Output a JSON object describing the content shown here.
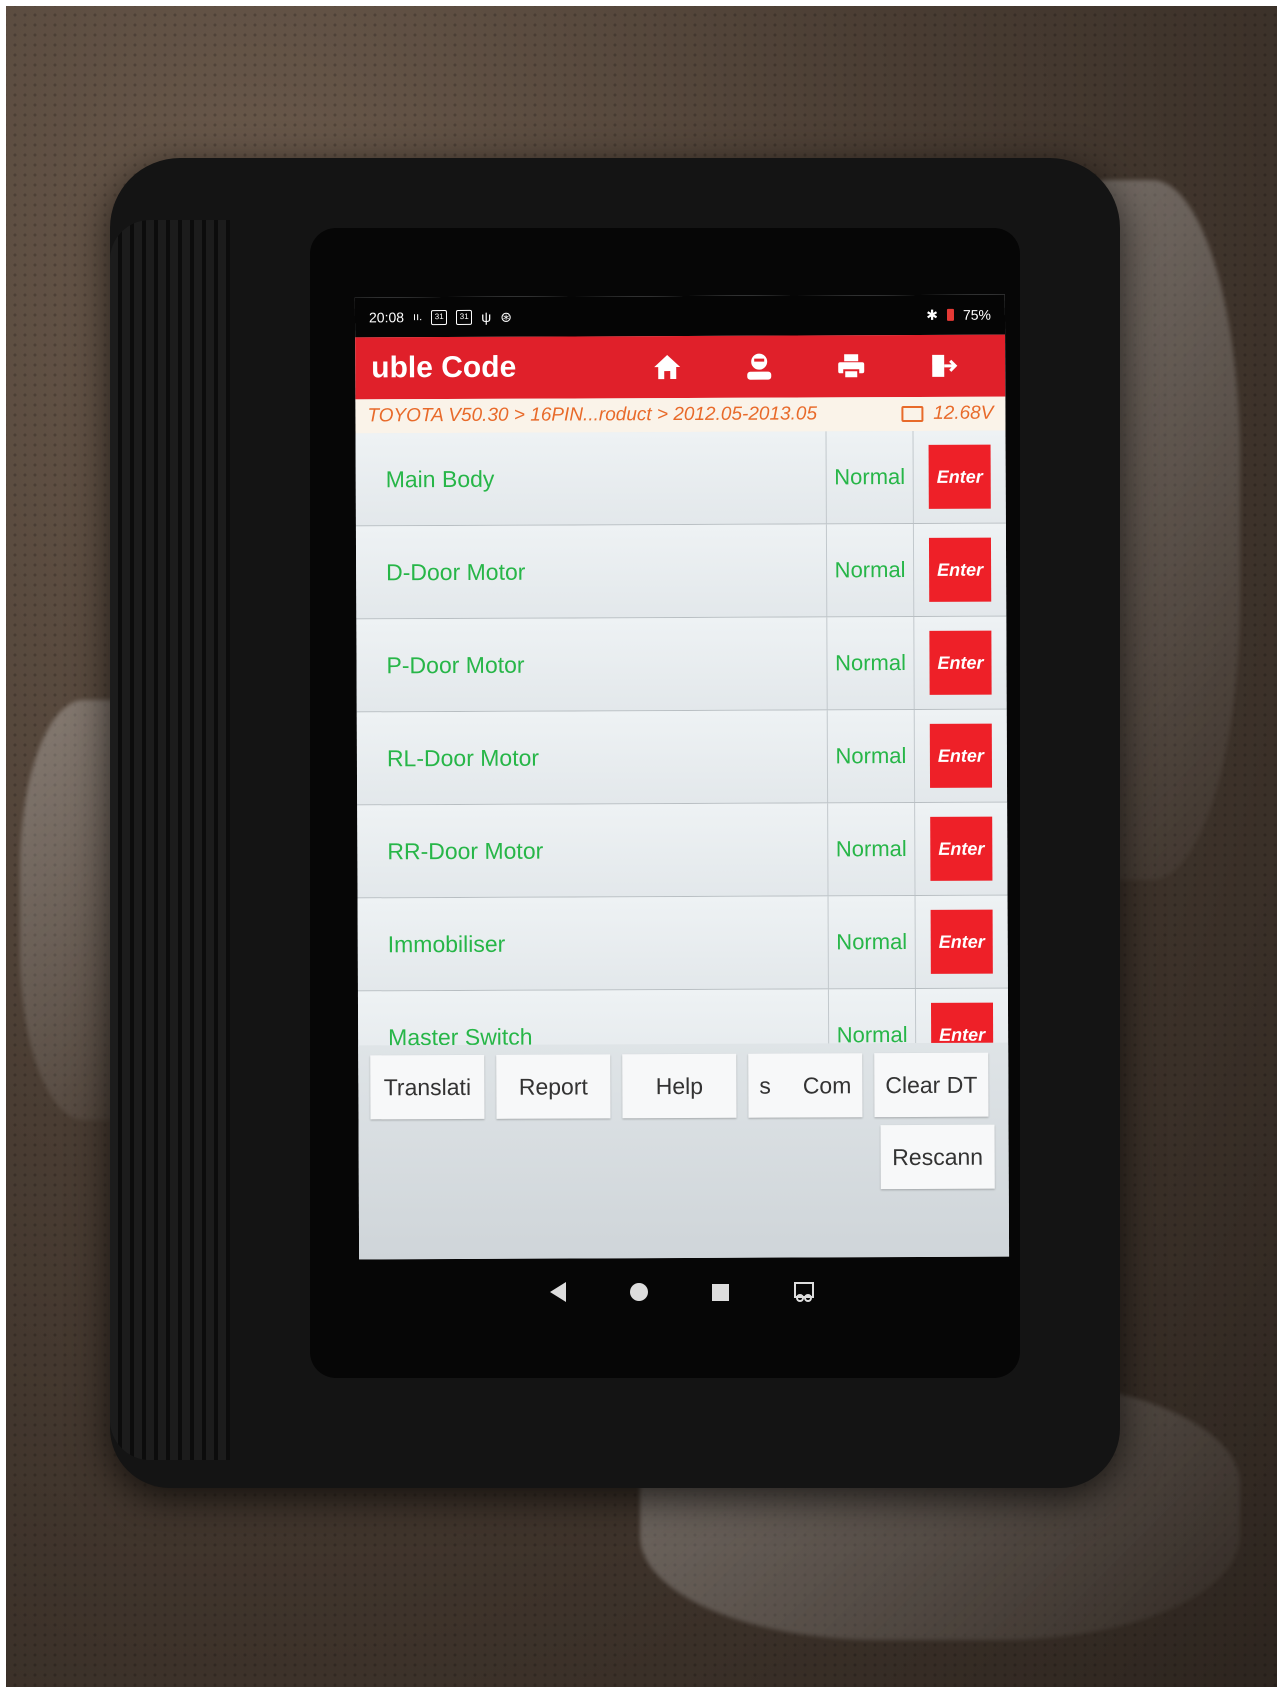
{
  "status_bar": {
    "time": "20:08",
    "battery": "75%"
  },
  "header": {
    "title": "uble Code"
  },
  "breadcrumb": {
    "path": "TOYOTA V50.30 > 16PIN...roduct > 2012.05-2013.05",
    "voltage": "12.68V"
  },
  "systems": [
    {
      "name": "Main Body",
      "status": "Normal",
      "action": "Enter"
    },
    {
      "name": "D-Door Motor",
      "status": "Normal",
      "action": "Enter"
    },
    {
      "name": "P-Door Motor",
      "status": "Normal",
      "action": "Enter"
    },
    {
      "name": "RL-Door Motor",
      "status": "Normal",
      "action": "Enter"
    },
    {
      "name": "RR-Door Motor",
      "status": "Normal",
      "action": "Enter"
    },
    {
      "name": "Immobiliser",
      "status": "Normal",
      "action": "Enter"
    },
    {
      "name": "Master Switch",
      "status": "Normal",
      "action": "Enter"
    }
  ],
  "footer": {
    "buttons": [
      "Translati",
      "Report",
      "Help",
      "s     Com",
      "Clear DT"
    ],
    "rescan": "Rescann"
  },
  "colors": {
    "accent": "#e0202a",
    "status": "#27b648",
    "enter": "#ee2028",
    "breadcrumb": "#e86a2a"
  }
}
